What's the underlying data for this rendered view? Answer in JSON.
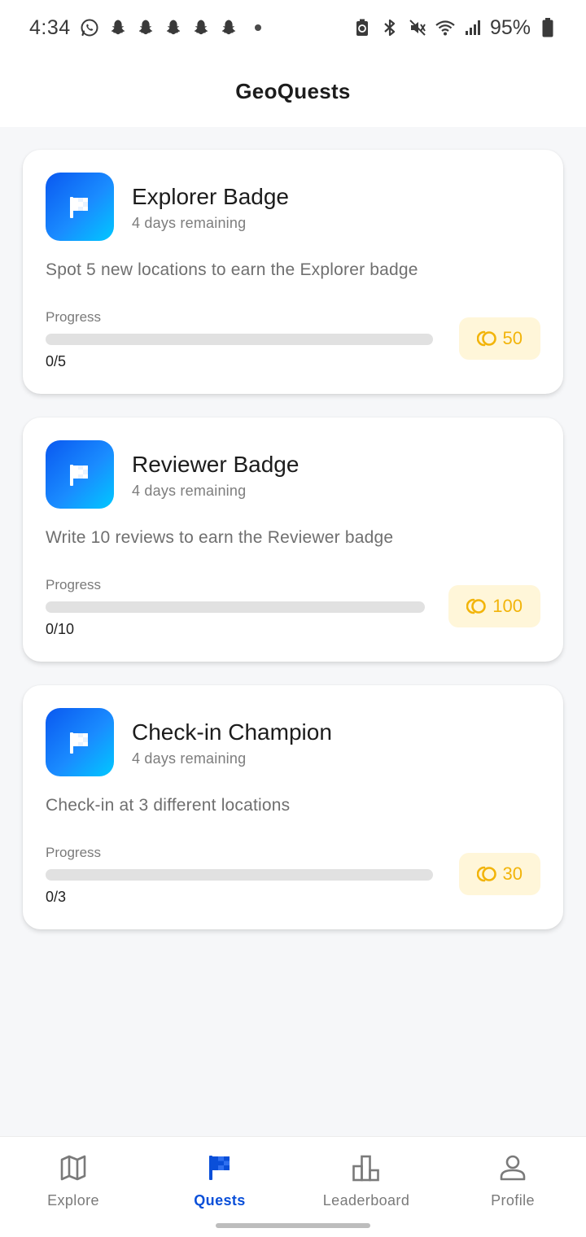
{
  "status_bar": {
    "time": "4:34",
    "battery": "95%",
    "left_icons": [
      "whatsapp-icon",
      "snapchat-icon",
      "snapchat-icon",
      "snapchat-icon",
      "snapchat-icon",
      "snapchat-icon",
      "dot-icon"
    ],
    "right_icons": [
      "battery-saver-icon",
      "bluetooth-icon",
      "vibrate-mute-icon",
      "wifi-icon",
      "signal-icon",
      "battery-icon"
    ]
  },
  "header": {
    "title": "GeoQuests"
  },
  "quests": [
    {
      "title": "Explorer Badge",
      "remaining": "4 days remaining",
      "description": "Spot 5 new locations to earn the Explorer badge",
      "progress_label": "Progress",
      "progress_text": "0/5",
      "progress_fraction": 0,
      "reward": "50",
      "icon": "flag-icon"
    },
    {
      "title": "Reviewer Badge",
      "remaining": "4 days remaining",
      "description": "Write 10 reviews to earn the Reviewer badge",
      "progress_label": "Progress",
      "progress_text": "0/10",
      "progress_fraction": 0,
      "reward": "100",
      "icon": "flag-icon"
    },
    {
      "title": "Check-in Champion",
      "remaining": "4 days remaining",
      "description": "Check-in at 3 different locations",
      "progress_label": "Progress",
      "progress_text": "0/3",
      "progress_fraction": 0,
      "reward": "30",
      "icon": "flag-icon"
    }
  ],
  "bottom_nav": {
    "items": [
      {
        "label": "Explore",
        "icon": "map-icon",
        "active": false
      },
      {
        "label": "Quests",
        "icon": "flag-icon",
        "active": true
      },
      {
        "label": "Leaderboard",
        "icon": "leaderboard-icon",
        "active": false
      },
      {
        "label": "Profile",
        "icon": "person-icon",
        "active": false
      }
    ]
  },
  "colors": {
    "accent": "#0a4fd9",
    "coin": "#f2b40a",
    "coin_bg": "#fff6d9",
    "track": "#e1e1e1"
  }
}
